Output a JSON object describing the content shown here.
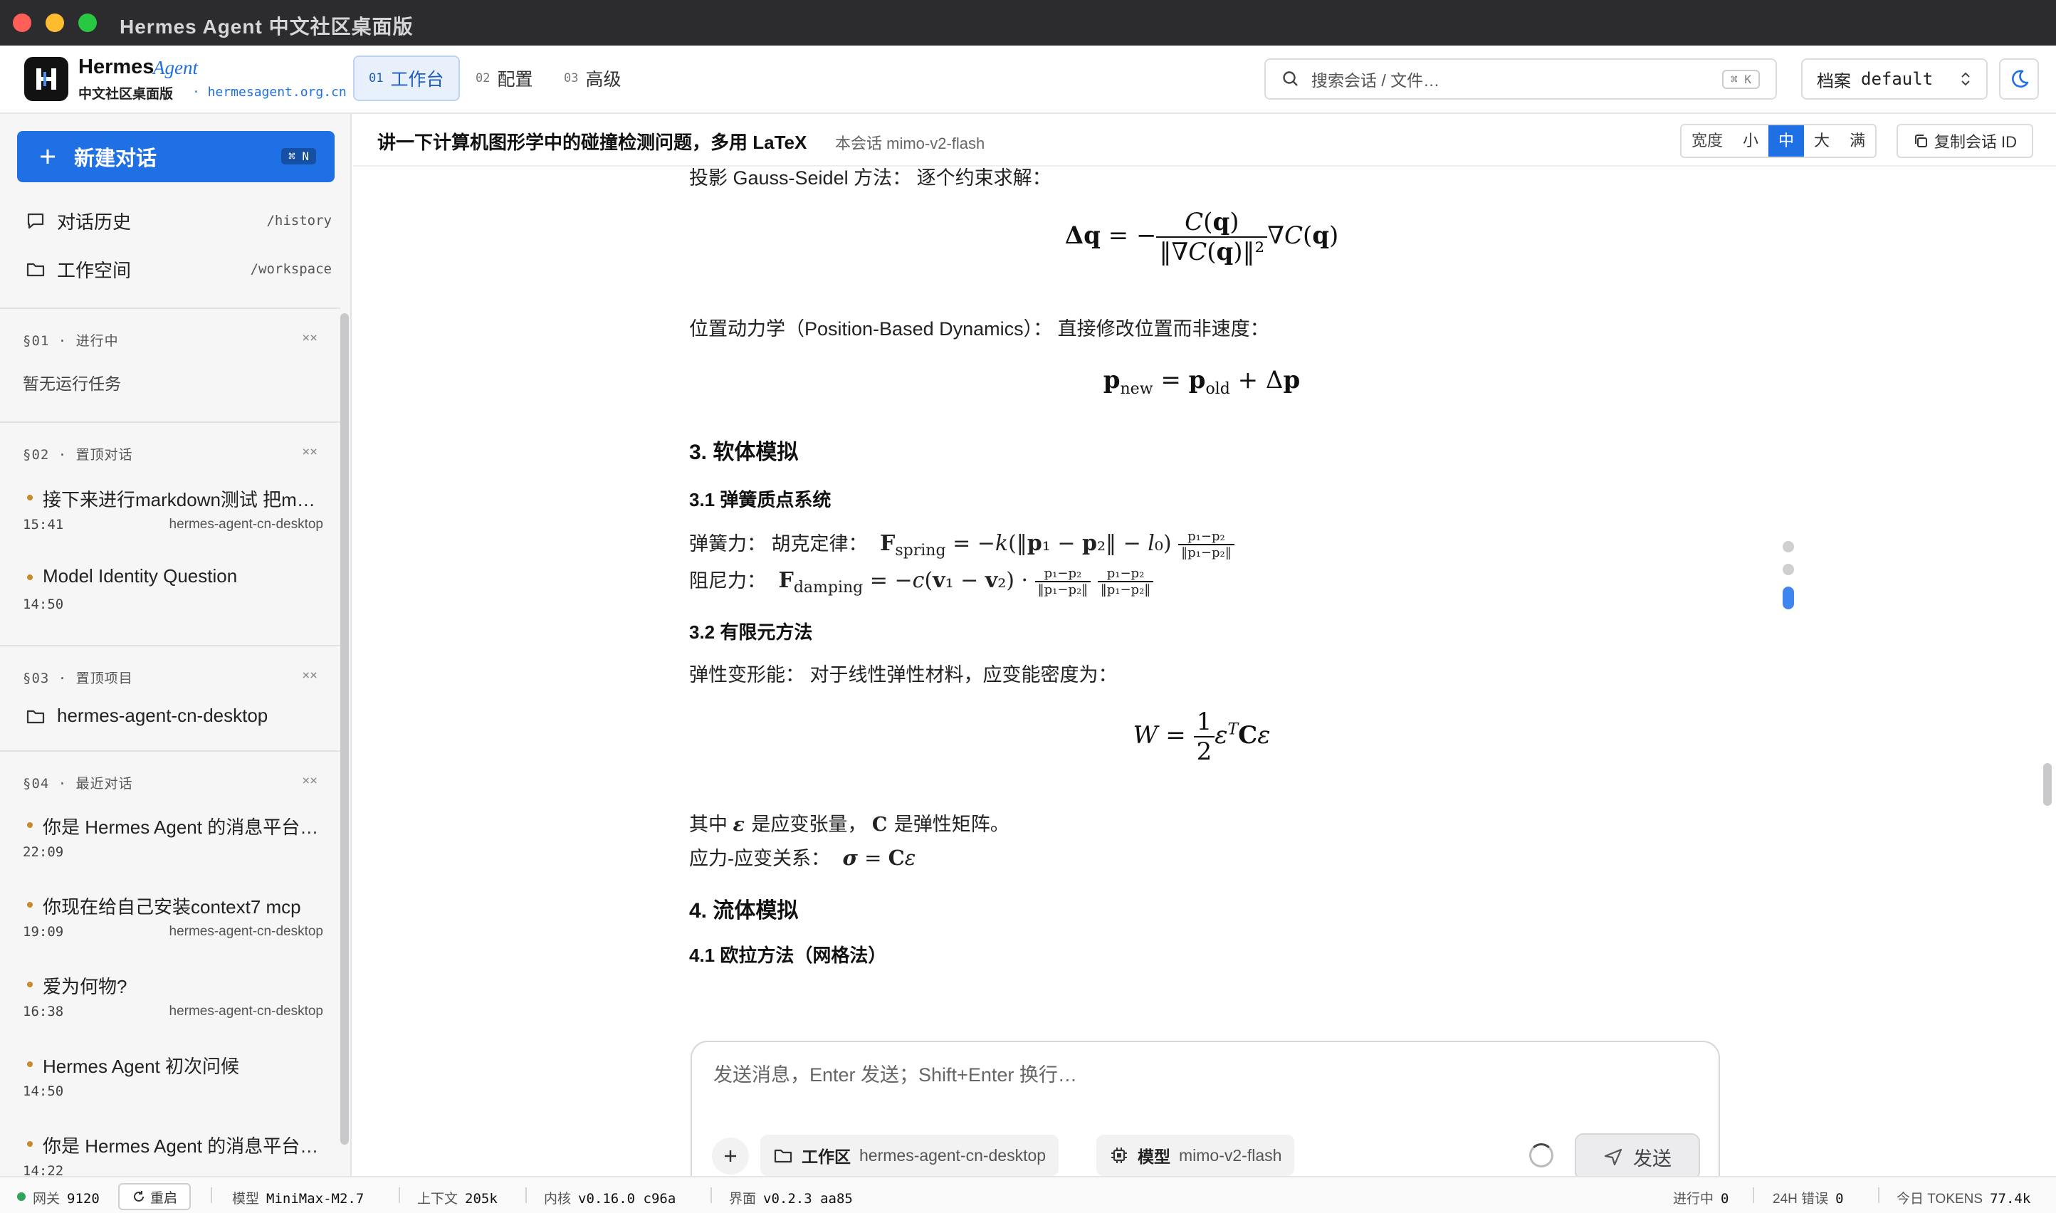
{
  "window": {
    "title": "Hermes Agent 中文社区桌面版"
  },
  "brand": {
    "name": "Hermes",
    "agent": "Agent",
    "subtitle": "中文社区桌面版",
    "url": "· hermesagent.org.cn"
  },
  "nav": {
    "tabs": [
      {
        "num": "01",
        "label": "工作台"
      },
      {
        "num": "02",
        "label": "配置"
      },
      {
        "num": "03",
        "label": "高级"
      }
    ]
  },
  "search": {
    "placeholder": "搜索会话 / 文件…",
    "shortcut": "⌘ K"
  },
  "profile": {
    "label": "档案",
    "value": "default"
  },
  "sidebar": {
    "new_chat": {
      "label": "新建对话",
      "shortcut": "⌘ N"
    },
    "links": [
      {
        "label": "对话历史",
        "path": "/history"
      },
      {
        "label": "工作空间",
        "path": "/workspace"
      }
    ],
    "sections": [
      {
        "head": "§01 · 进行中",
        "close": "××",
        "empty": "暂无运行任务"
      },
      {
        "head": "§02 · 置顶对话",
        "close": "××",
        "items": [
          {
            "title": "接下来进行markdown测试 把m…",
            "time": "15:41",
            "workspace": "hermes-agent-cn-desktop"
          },
          {
            "title": "Model Identity Question",
            "time": "14:50",
            "workspace": ""
          }
        ]
      },
      {
        "head": "§03 · 置顶项目",
        "close": "××",
        "project": "hermes-agent-cn-desktop"
      },
      {
        "head": "§04 · 最近对话",
        "close": "××",
        "items": [
          {
            "title": "你是 Hermes Agent 的消息平台…",
            "time": "22:09",
            "workspace": ""
          },
          {
            "title": "你现在给自己安装context7 mcp",
            "time": "19:09",
            "workspace": "hermes-agent-cn-desktop"
          },
          {
            "title": "爱为何物?",
            "time": "16:38",
            "workspace": "hermes-agent-cn-desktop"
          },
          {
            "title": "Hermes Agent 初次问候",
            "time": "14:50",
            "workspace": ""
          },
          {
            "title": "你是 Hermes Agent 的消息平台…",
            "time": "14:22",
            "workspace": ""
          }
        ]
      }
    ]
  },
  "conversation": {
    "title": "讲一下计算机图形学中的碰撞检测问题，多用 LaTeX",
    "model_note": "本会话 mimo-v2-flash",
    "width": {
      "label": "宽度",
      "options": [
        "小",
        "中",
        "大",
        "满"
      ],
      "selected": "中"
    },
    "copy_id": "复制会话 ID"
  },
  "doc": {
    "p1": "投影 Gauss-Seidel 方法： 逐个约束求解：",
    "p2": "位置动力学（Position-Based Dynamics）： 直接修改位置而非速度：",
    "h_soft": "3. 软体模拟",
    "h_spring": "3.1 弹簧质点系统",
    "spring_label": "弹簧力： 胡克定律：",
    "damping_label": "阻尼力：",
    "h_fem": "3.2 有限元方法",
    "fem_text": "弹性变形能： 对于线性弹性材料，应变能密度为：",
    "strain_a": "其中",
    "strain_b": "是应变张量，",
    "strain_c": "是弹性矩阵。",
    "stress_label": "应力-应变关系：",
    "h_fluid": "4. 流体模拟",
    "h_euler": "4.1 欧拉方法（网格法）"
  },
  "composer": {
    "placeholder": "发送消息，Enter 发送；Shift+Enter 换行…",
    "workspace_key": "工作区",
    "workspace_value": "hermes-agent-cn-desktop",
    "model_key": "模型",
    "model_value": "mimo-v2-flash",
    "send": "发送"
  },
  "status": {
    "gateway_label": "网关",
    "gateway_value": "9120",
    "restart": "重启",
    "model_label": "模型",
    "model_value": "MiniMax-M2.7",
    "context_label": "上下文",
    "context_value": "205k",
    "kernel_label": "内核",
    "kernel_value": "v0.16.0 c96a",
    "ui_label": "界面",
    "ui_value": "v0.2.3 aa85",
    "running_label": "进行中",
    "running_value": "0",
    "errors_label": "24H 错误",
    "errors_value": "0",
    "tokens_label": "今日 TOKENS",
    "tokens_value": "77.4k"
  },
  "colors": {
    "accent": "#1f6fe5",
    "dot": "#c88a2a",
    "status_ok": "#2fa45a"
  }
}
